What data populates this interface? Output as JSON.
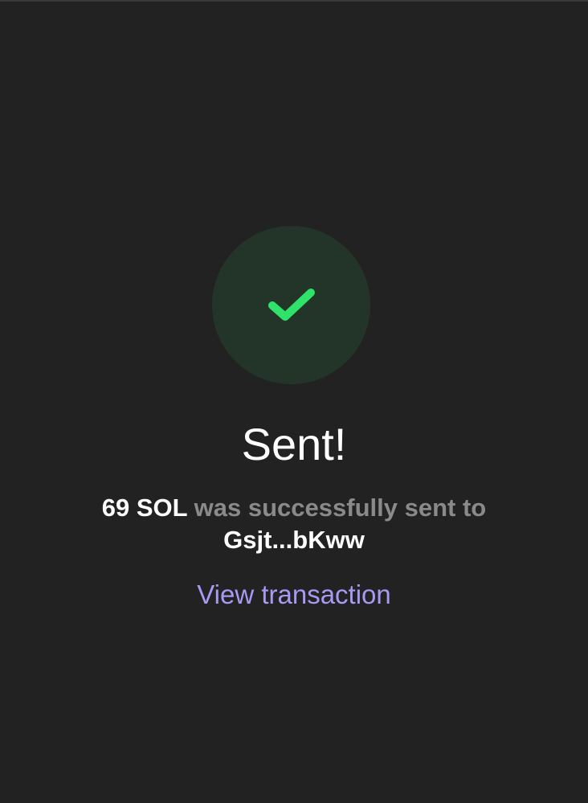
{
  "status": {
    "icon": "checkmark-icon",
    "title": "Sent!"
  },
  "message": {
    "amount": "69 SOL",
    "text": "was successfully sent to",
    "recipient": "Gsjt...bKww"
  },
  "actions": {
    "view_transaction": "View transaction"
  },
  "colors": {
    "background": "#222222",
    "success_circle": "#233528",
    "success_check": "#2ee26a",
    "link": "#a79af2",
    "secondary_text": "#8a8a8a",
    "primary_text": "#ffffff"
  }
}
